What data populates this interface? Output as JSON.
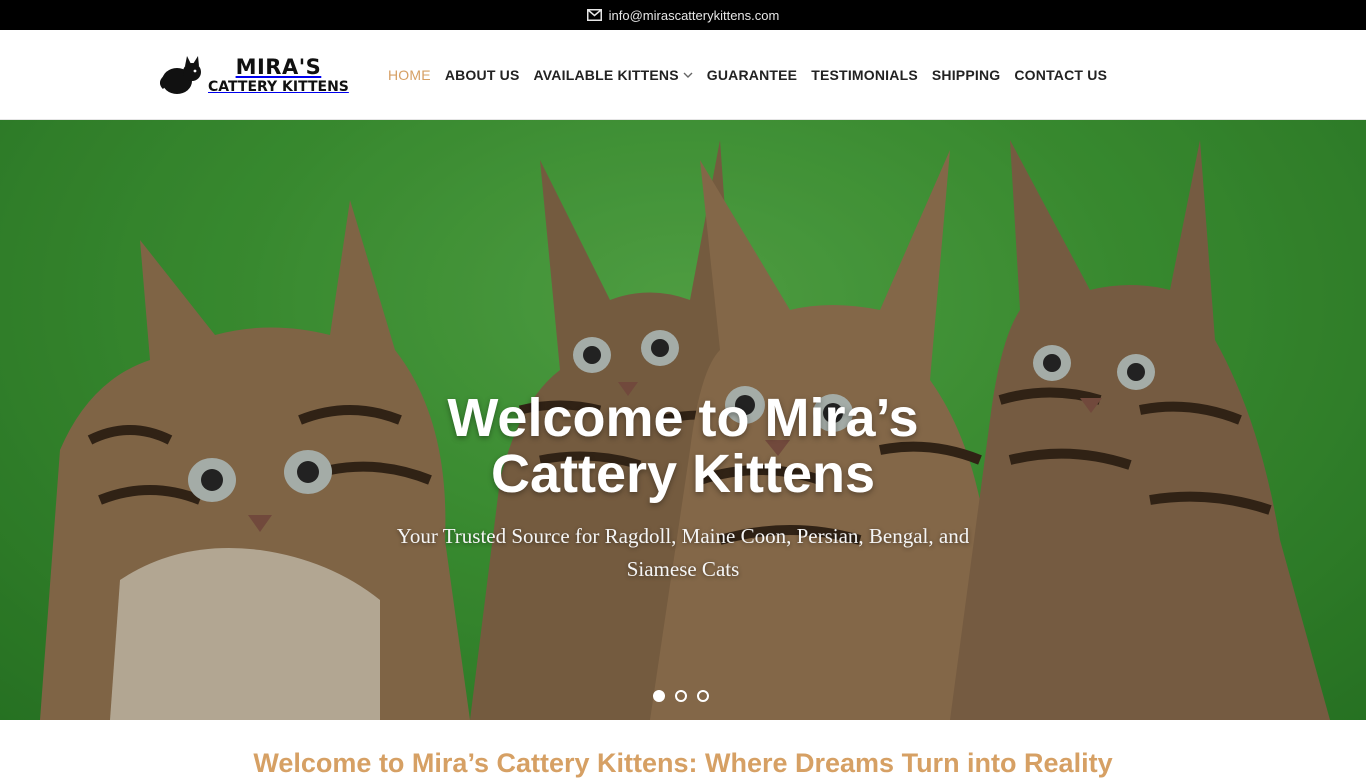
{
  "topbar": {
    "email": "info@mirascatterykittens.com",
    "email_icon": "envelope-icon"
  },
  "header": {
    "logo": {
      "line1": "MIRA'S",
      "line2": "CATTERY KITTENS",
      "icon": "cat-silhouette-icon"
    },
    "nav": [
      {
        "label": "HOME",
        "active": true
      },
      {
        "label": "ABOUT US"
      },
      {
        "label": "AVAILABLE KITTENS",
        "has_dropdown": true
      },
      {
        "label": "GUARANTEE"
      },
      {
        "label": "TESTIMONIALS"
      },
      {
        "label": "SHIPPING"
      },
      {
        "label": "CONTACT US"
      }
    ]
  },
  "hero": {
    "title": "Welcome to Mira’s Cattery Kittens",
    "subtitle": "Your Trusted Source for Ragdoll, Maine Coon, Persian, Bengal, and Siamese Cats",
    "slide_count": 3,
    "active_slide": 1
  },
  "section": {
    "heading": "Welcome to Mira’s Cattery Kittens: Where Dreams Turn into Reality"
  },
  "colors": {
    "accent": "#d6a064",
    "topbar_bg": "#000000",
    "hero_green": "#4aae3d"
  }
}
